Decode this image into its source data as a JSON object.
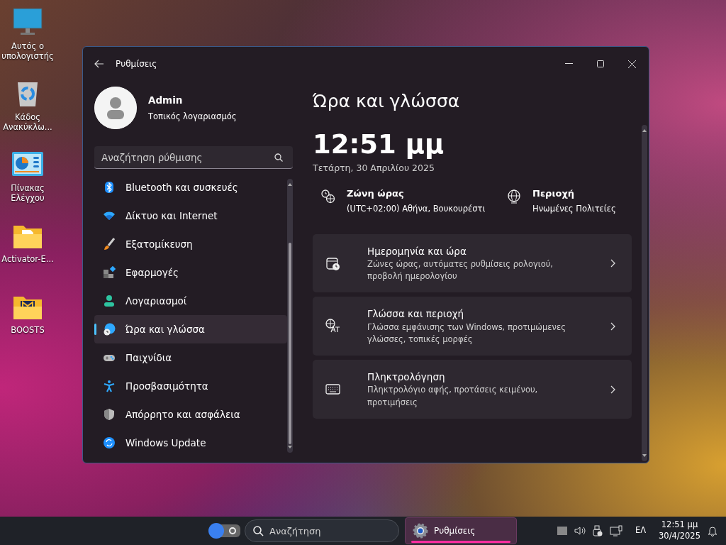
{
  "desktop_icons": [
    {
      "label": "Αυτός ο υπολογιστής"
    },
    {
      "label": "Κάδος Ανακύκλω..."
    },
    {
      "label": "Πίνακας Ελέγχου"
    },
    {
      "label": "Activator-E..."
    },
    {
      "label": "BOOSTS"
    }
  ],
  "window": {
    "title": "Ρυθμίσεις",
    "user": {
      "name": "Admin",
      "account": "Τοπικός λογαριασμός"
    },
    "search": {
      "placeholder": "Αναζήτηση ρύθμισης"
    },
    "nav": [
      {
        "label": "Bluetooth και συσκευές",
        "selected": false
      },
      {
        "label": "Δίκτυο και Internet",
        "selected": false
      },
      {
        "label": "Εξατομίκευση",
        "selected": false
      },
      {
        "label": "Εφαρμογές",
        "selected": false
      },
      {
        "label": "Λογαριασμοί",
        "selected": false
      },
      {
        "label": "Ώρα και γλώσσα",
        "selected": true
      },
      {
        "label": "Παιχνίδια",
        "selected": false
      },
      {
        "label": "Προσβασιμότητα",
        "selected": false
      },
      {
        "label": "Απόρρητο και ασφάλεια",
        "selected": false
      },
      {
        "label": "Windows Update",
        "selected": false
      }
    ],
    "page_title": "Ώρα και γλώσσα",
    "clock": {
      "time": "12:51 μμ",
      "date": "Τετάρτη, 30 Απριλίου 2025"
    },
    "info": [
      {
        "title": "Ζώνη ώρας",
        "value": "(UTC+02:00) Αθήνα, Βουκουρέστι"
      },
      {
        "title": "Περιοχή",
        "value": "Ηνωμένες Πολιτείες"
      }
    ],
    "cards": [
      {
        "title": "Ημερομηνία και ώρα",
        "description": "Ζώνες ώρας, αυτόματες ρυθμίσεις ρολογιού, προβολή ημερολογίου"
      },
      {
        "title": "Γλώσσα και περιοχή",
        "description": "Γλώσσα εμφάνισης των Windows, προτιμώμενες γλώσσες, τοπικές μορφές"
      },
      {
        "title": "Πληκτρολόγηση",
        "description": "Πληκτρολόγιο αφής, προτάσεις κειμένου, προτιμήσεις"
      }
    ]
  },
  "taskbar": {
    "search": {
      "placeholder": "Αναζήτηση"
    },
    "apps": [
      {
        "label": "Ρυθμίσεις",
        "selected": true
      }
    ],
    "tray": {
      "language": "ΕΛ",
      "time": "12:51 μμ",
      "date": "30/4/2025"
    }
  }
}
